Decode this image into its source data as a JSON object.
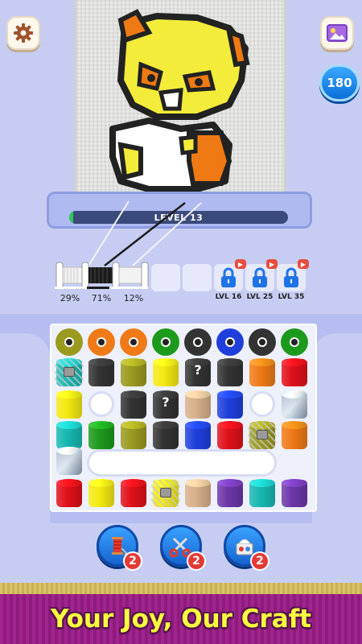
{
  "top": {
    "settings_icon": "gear-icon",
    "gallery_icon": "picture-icon",
    "coins": "180"
  },
  "canvas": {
    "level_label": "LEVEL 13",
    "progress": 0.02
  },
  "spools": [
    {
      "percent": "29%",
      "color": "#f2f2f2"
    },
    {
      "percent": "71%",
      "color": "#1c1c1c"
    },
    {
      "percent": "12%",
      "color": "#f2f2f2"
    }
  ],
  "locked_slots": [
    {
      "label": "LVL 16"
    },
    {
      "label": "LVL 25"
    },
    {
      "label": "LVL 35"
    }
  ],
  "question_mark": "?",
  "boosters": [
    {
      "icon": "thread-spool-icon",
      "count": "2"
    },
    {
      "icon": "scissors-icon",
      "count": "2"
    },
    {
      "icon": "magic-box-icon",
      "count": "2"
    }
  ],
  "footer": {
    "tagline": "Your Joy, Our Craft"
  },
  "colors": {
    "olive": "#9a9a1f",
    "orange": "#f07a17",
    "green": "#1c9a1c",
    "black": "#333333",
    "blue": "#1f3fdc",
    "red": "#e0101a",
    "yellow": "#f4ea13",
    "teal": "#18b8b2",
    "tan": "#d7b08a",
    "purple": "#6c36a8"
  }
}
